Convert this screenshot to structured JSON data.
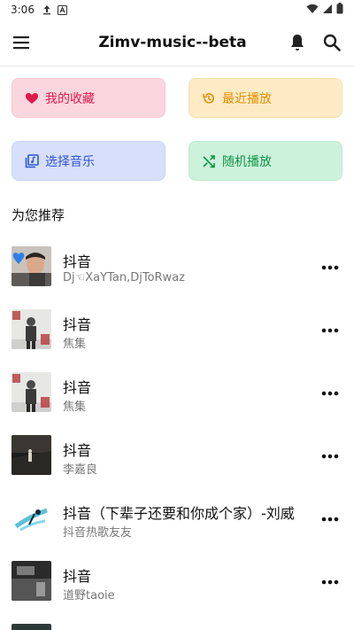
{
  "status_bar": {
    "time": "3:06"
  },
  "app_bar": {
    "title": "Zimv-music--beta"
  },
  "quick_actions": {
    "favorites": "我的收藏",
    "recent": "最近播放",
    "select_music": "选择音乐",
    "shuffle": "随机播放"
  },
  "section_title": "为您推荐",
  "songs": [
    {
      "title": "抖音",
      "artist": "Dj☜XaYTan,DjToRwaz"
    },
    {
      "title": "抖音",
      "artist": "焦集"
    },
    {
      "title": "抖音",
      "artist": "焦集"
    },
    {
      "title": "抖音",
      "artist": "李嘉良"
    },
    {
      "title": "抖音（下辈子还要和你成个家）-刘威",
      "artist": "抖音热歌友友"
    },
    {
      "title": "抖音",
      "artist": "道野taoie"
    }
  ],
  "colors": {
    "favorites": "#e0194c",
    "recent": "#e08e00",
    "select_music": "#2f55d4",
    "shuffle": "#119443"
  }
}
